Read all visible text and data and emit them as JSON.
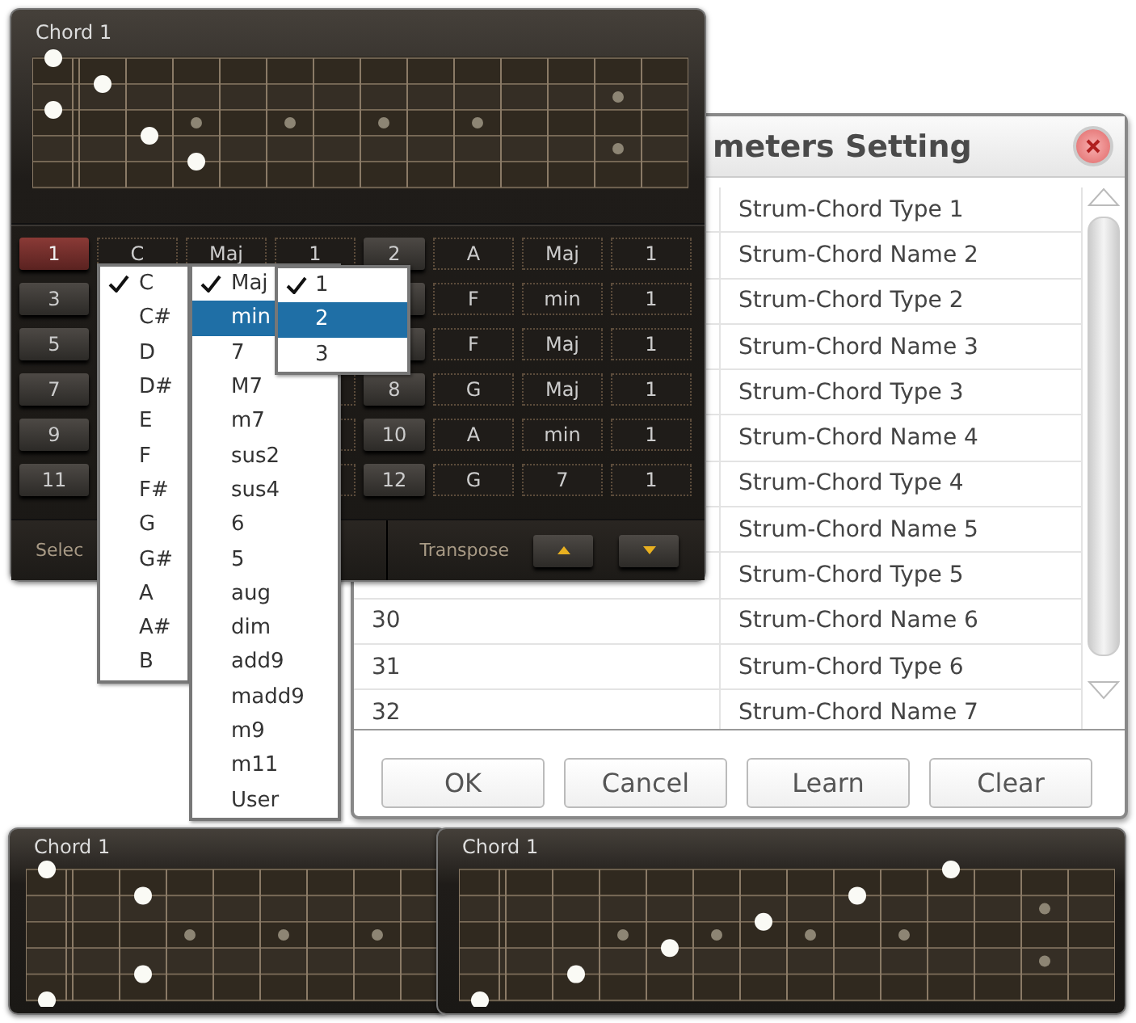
{
  "chord_window": {
    "title": "Chord 1",
    "slots": [
      {
        "number": "1",
        "root": "C",
        "type": "Maj",
        "variant": "1",
        "selected": true
      },
      {
        "number": "2",
        "root": "A",
        "type": "Maj",
        "variant": "1",
        "selected": false
      },
      {
        "number": "3",
        "selected": false
      },
      {
        "root": "F",
        "type": "min",
        "variant": "1",
        "selected": false
      },
      {
        "number": "5",
        "selected": false
      },
      {
        "root": "F",
        "type": "Maj",
        "variant": "1",
        "selected": false
      },
      {
        "number": "7",
        "selected": false
      },
      {
        "number": "8",
        "root": "G",
        "type": "Maj",
        "variant": "1",
        "selected": false
      },
      {
        "number": "9",
        "selected": false
      },
      {
        "number": "10",
        "root": "A",
        "type": "min",
        "variant": "1",
        "selected": false
      },
      {
        "number": "11",
        "selected": false
      },
      {
        "number": "12",
        "root": "G",
        "type": "7",
        "variant": "1",
        "selected": false
      }
    ],
    "select_label": "Selec",
    "transpose_label": "Transpose"
  },
  "root_menu": [
    {
      "label": "C",
      "checked": true,
      "selected": false
    },
    {
      "label": "C#",
      "checked": false,
      "selected": false
    },
    {
      "label": "D",
      "checked": false,
      "selected": false
    },
    {
      "label": "D#",
      "checked": false,
      "selected": false
    },
    {
      "label": "E",
      "checked": false,
      "selected": false
    },
    {
      "label": "F",
      "checked": false,
      "selected": false
    },
    {
      "label": "F#",
      "checked": false,
      "selected": false
    },
    {
      "label": "G",
      "checked": false,
      "selected": false
    },
    {
      "label": "G#",
      "checked": false,
      "selected": false
    },
    {
      "label": "A",
      "checked": false,
      "selected": false
    },
    {
      "label": "A#",
      "checked": false,
      "selected": false
    },
    {
      "label": "B",
      "checked": false,
      "selected": false
    }
  ],
  "type_menu": [
    {
      "label": "Maj",
      "checked": true,
      "selected": false
    },
    {
      "label": "min",
      "checked": false,
      "selected": true
    },
    {
      "label": "7",
      "checked": false,
      "selected": false
    },
    {
      "label": "M7",
      "checked": false,
      "selected": false
    },
    {
      "label": "m7",
      "checked": false,
      "selected": false
    },
    {
      "label": "sus2",
      "checked": false,
      "selected": false
    },
    {
      "label": "sus4",
      "checked": false,
      "selected": false
    },
    {
      "label": "6",
      "checked": false,
      "selected": false
    },
    {
      "label": "5",
      "checked": false,
      "selected": false
    },
    {
      "label": "aug",
      "checked": false,
      "selected": false
    },
    {
      "label": "dim",
      "checked": false,
      "selected": false
    },
    {
      "label": "add9",
      "checked": false,
      "selected": false
    },
    {
      "label": "madd9",
      "checked": false,
      "selected": false
    },
    {
      "label": "m9",
      "checked": false,
      "selected": false
    },
    {
      "label": "m11",
      "checked": false,
      "selected": false
    },
    {
      "label": "User",
      "checked": false,
      "selected": false
    }
  ],
  "variant_menu": [
    {
      "label": "1",
      "checked": true,
      "selected": false
    },
    {
      "label": "2",
      "checked": false,
      "selected": true
    },
    {
      "label": "3",
      "checked": false,
      "selected": false
    }
  ],
  "settings_dialog": {
    "title": "meters Setting",
    "rows": [
      {
        "name": "Strum-Chord Type 1"
      },
      {
        "name": "Strum-Chord Name 2"
      },
      {
        "name": "Strum-Chord Type 2"
      },
      {
        "name": "Strum-Chord Name 3"
      },
      {
        "name": "Strum-Chord Type 3"
      },
      {
        "name": "Strum-Chord Name 4"
      },
      {
        "name": "Strum-Chord Type 4"
      },
      {
        "name": "Strum-Chord Name 5"
      },
      {
        "name": "Strum-Chord Type 5"
      },
      {
        "number": "30",
        "name": "Strum-Chord Name 6"
      },
      {
        "number": "31",
        "name": "Strum-Chord Type 6"
      },
      {
        "number": "32",
        "name": "Strum-Chord Name 7"
      }
    ],
    "buttons": [
      "OK",
      "Cancel",
      "Learn",
      "Clear"
    ]
  },
  "preview_windows": [
    {
      "title": "Chord 1"
    },
    {
      "title": "Chord 1"
    }
  ]
}
